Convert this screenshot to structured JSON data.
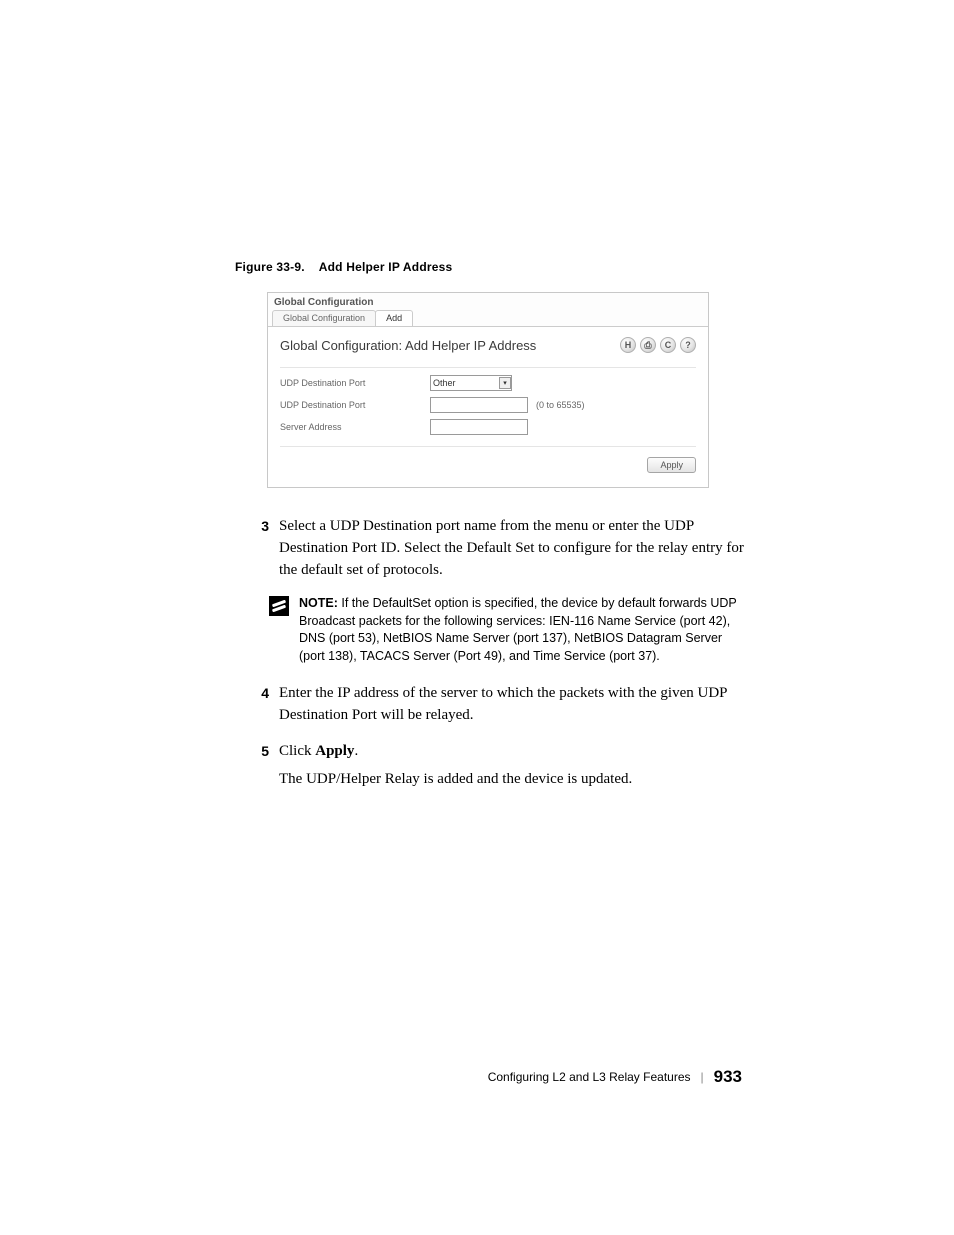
{
  "figure": {
    "ref": "Figure 33-9.",
    "title": "Add Helper IP Address"
  },
  "screenshot": {
    "windowTitle": "Global Configuration",
    "tabs": [
      "Global Configuration",
      "Add"
    ],
    "heading": "Global Configuration: Add Helper IP Address",
    "icons": {
      "save": "H",
      "print": "⎙",
      "refresh": "C",
      "help": "?"
    },
    "form": {
      "row1": {
        "label": "UDP Destination Port",
        "selectValue": "Other"
      },
      "row2": {
        "label": "UDP Destination Port",
        "range": "(0 to 65535)"
      },
      "row3": {
        "label": "Server Address"
      }
    },
    "applyBtn": "Apply"
  },
  "steps": {
    "s3": {
      "num": "3",
      "text": "Select a UDP Destination port name from the menu or enter the UDP Destination Port ID. Select the Default Set to configure for the relay entry for the default set of protocols."
    },
    "note": {
      "label": "NOTE:",
      "text": " If the DefaultSet option is specified, the device by default forwards UDP Broadcast packets for the following services: IEN-116 Name Service (port 42), DNS (port 53), NetBIOS Name Server (port 137), NetBIOS Datagram Server (port 138), TACACS Server (Port 49), and Time Service (port 37)."
    },
    "s4": {
      "num": "4",
      "text": "Enter the IP address of the server to which the packets with the given UDP Destination Port will be relayed."
    },
    "s5": {
      "num": "5",
      "pre": "Click ",
      "bold": "Apply",
      "post": ".",
      "line2": "The UDP/Helper Relay is added and the device is updated."
    }
  },
  "footer": {
    "section": "Configuring L2 and L3 Relay Features",
    "page": "933"
  }
}
